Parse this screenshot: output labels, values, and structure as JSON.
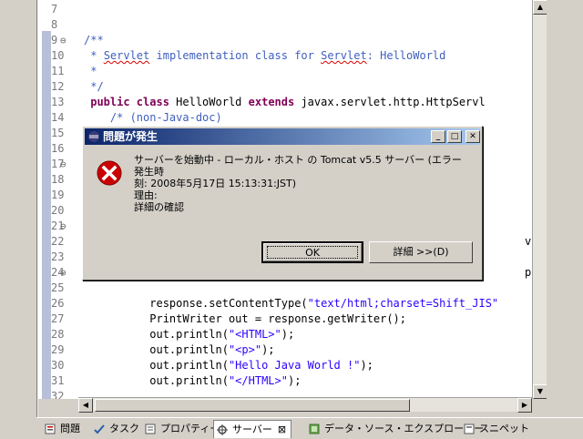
{
  "editor": {
    "lines": [
      {
        "n": "7",
        "fold": "",
        "html": ""
      },
      {
        "n": "8",
        "fold": "",
        "html": ""
      },
      {
        "n": "9",
        "fold": "⊖",
        "html": "<span class='comment'>/**</span>"
      },
      {
        "n": "10",
        "fold": "",
        "html": "<span class='comment'> * <span class='squiggle'>Servlet</span> implementation class for <span class='squiggle'>Servlet</span>: HelloWorld</span>"
      },
      {
        "n": "11",
        "fold": "",
        "html": "<span class='comment'> *</span>"
      },
      {
        "n": "12",
        "fold": "",
        "html": "<span class='comment'> */</span>"
      },
      {
        "n": "13",
        "fold": "",
        "html": " <span class='kw'>public class</span> HelloWorld <span class='kw'>extends</span> javax.servlet.http.HttpServl"
      },
      {
        "n": "14",
        "fold": "",
        "html": "    <span class='comment'>/* (non-Java-doc)</span>"
      },
      {
        "n": "15",
        "fold": "",
        "html": ""
      },
      {
        "n": "16",
        "fold": "",
        "html": ""
      },
      {
        "n": "17",
        "fold": "⊖",
        "html": ""
      },
      {
        "n": "18",
        "fold": "",
        "html": ""
      },
      {
        "n": "19",
        "fold": "",
        "html": ""
      },
      {
        "n": "20",
        "fold": "",
        "html": ""
      },
      {
        "n": "21",
        "fold": "⊖",
        "html": ""
      },
      {
        "n": "22",
        "fold": "",
        "html": "                                                                   vletR"
      },
      {
        "n": "23",
        "fold": "",
        "html": ""
      },
      {
        "n": "24",
        "fold": "⊖",
        "html": "                                                                   pServ"
      },
      {
        "n": "25",
        "fold": "",
        "html": ""
      },
      {
        "n": "26",
        "fold": "",
        "html": "          response.setContentType(<span class='string'>\"text/html;charset=Shift_JIS\"</span>"
      },
      {
        "n": "27",
        "fold": "",
        "html": "          PrintWriter out = response.getWriter();"
      },
      {
        "n": "28",
        "fold": "",
        "html": "          out.println(<span class='string'>\"&lt;HTML&gt;\"</span>);"
      },
      {
        "n": "29",
        "fold": "",
        "html": "          out.println(<span class='string'>\"&lt;p&gt;\"</span>);"
      },
      {
        "n": "30",
        "fold": "",
        "html": "          out.println(<span class='string'>\"Hello Java World !\"</span>);"
      },
      {
        "n": "31",
        "fold": "",
        "html": "          out.println(<span class='string'>\"&lt;/HTML&gt;\"</span>);"
      },
      {
        "n": "32",
        "fold": "",
        "html": ""
      }
    ]
  },
  "tabs": [
    {
      "label": "問題",
      "icon": "problems-icon",
      "active": false
    },
    {
      "label": "タスク",
      "icon": "tasks-icon",
      "active": false
    },
    {
      "label": "プロパティー",
      "icon": "properties-icon",
      "active": false
    },
    {
      "label": "サーバー",
      "icon": "servers-icon",
      "active": true
    },
    {
      "label": "データ・ソース・エクスプローラー",
      "icon": "datasource-explorer-icon",
      "active": false
    },
    {
      "label": "スニペット",
      "icon": "snippets-icon",
      "active": false
    }
  ],
  "dialog": {
    "title": "問題が発生",
    "message_line1": "サーバーを始動中 - ローカル・ホスト の Tomcat v5.5 サーバー (エラー発生時",
    "message_line2": "刻: 2008年5月17日 15:13:31:JST)",
    "reason_label": "理由:",
    "reason_text": "詳細の確認",
    "ok_label": "OK",
    "details_label": "詳細 >>(D)"
  },
  "colors": {
    "title_start": "#0a246a",
    "title_end": "#a6caf0",
    "error_red": "#cc0000",
    "keyword": "#7f0055",
    "comment": "#3f5fbf",
    "string": "#2a00ff"
  }
}
